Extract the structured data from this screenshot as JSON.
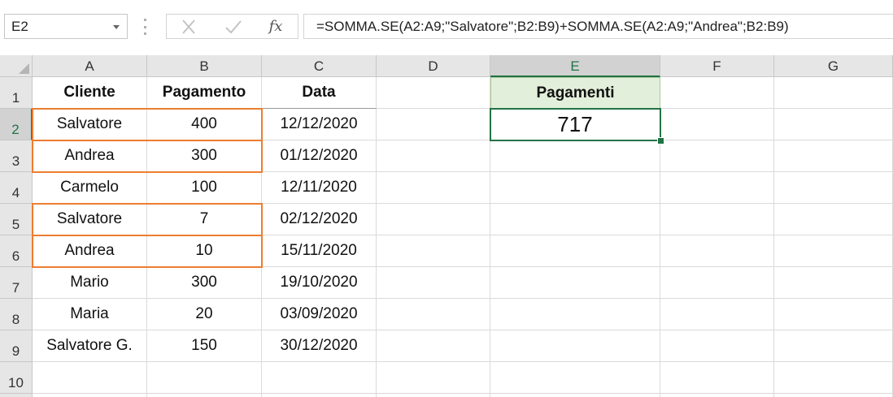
{
  "formula_bar": {
    "name_box": "E2",
    "fx_label": "fx",
    "formula": "=SOMMA.SE(A2:A9;\"Salvatore\";B2:B9)+SOMMA.SE(A2:A9;\"Andrea\";B2:B9)"
  },
  "columns": [
    "A",
    "B",
    "C",
    "D",
    "E",
    "F",
    "G"
  ],
  "rows": [
    "1",
    "2",
    "3",
    "4",
    "5",
    "6",
    "7",
    "8",
    "9",
    "10"
  ],
  "table": {
    "headers": [
      "Cliente",
      "Pagamento",
      "Data"
    ],
    "rows": [
      [
        "Salvatore",
        "400",
        "12/12/2020"
      ],
      [
        "Andrea",
        "300",
        "01/12/2020"
      ],
      [
        "Carmelo",
        "100",
        "12/11/2020"
      ],
      [
        "Salvatore",
        "7",
        "02/12/2020"
      ],
      [
        "Andrea",
        "10",
        "15/11/2020"
      ],
      [
        "Mario",
        "300",
        "19/10/2020"
      ],
      [
        "Maria",
        "20",
        "03/09/2020"
      ],
      [
        "Salvatore G.",
        "150",
        "30/12/2020"
      ]
    ]
  },
  "summary": {
    "header": "Pagamenti",
    "value": "717"
  },
  "colors": {
    "accent": "#217346",
    "highlight": "#ed7d31",
    "header_fill": "#e2efda"
  },
  "icons": [
    "cancel-icon",
    "enter-icon",
    "fx-icon",
    "dropdown-arrow-icon"
  ]
}
